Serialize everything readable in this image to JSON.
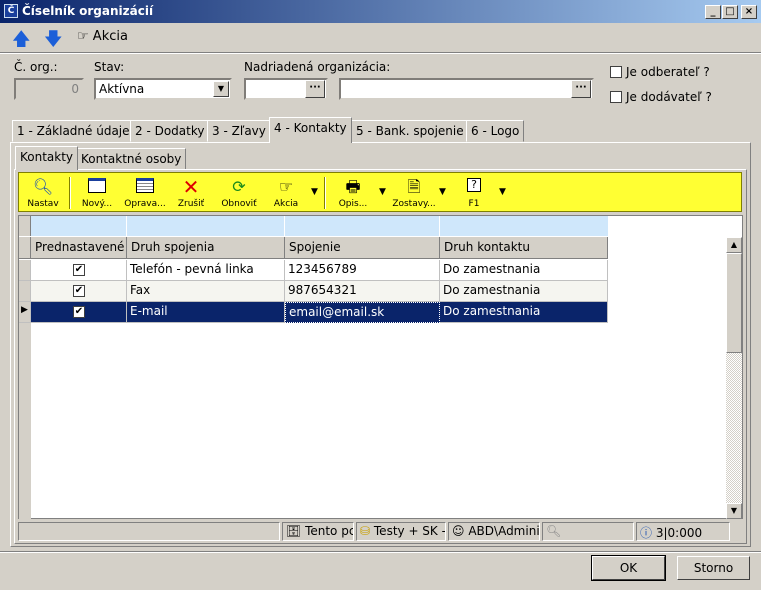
{
  "window": {
    "title": "Číselník organizácií",
    "icon": "app-icon"
  },
  "topbar": {
    "up_icon": "arrow-up-icon",
    "down_icon": "arrow-down-icon",
    "akcia": "Akcia"
  },
  "form": {
    "cislo_label": "Č. org.:",
    "cislo_value": "0",
    "stav_label": "Stav:",
    "stav_value": "Aktívna",
    "nadriadena_label": "Nadriadená organizácia:",
    "odberatel_label": "Je odberateľ ?",
    "dodavatel_label": "Je dodávateľ ?"
  },
  "tabs": [
    "1 - Základné údaje",
    "2 - Dodatky",
    "3 - Zľavy",
    "4 - Kontakty",
    "5 - Bank. spojenie",
    "6 - Logo"
  ],
  "subtabs": [
    "Kontakty",
    "Kontaktné osoby"
  ],
  "toolbar": {
    "nastav": "Nastav",
    "novy": "Nový...",
    "oprava": "Oprava...",
    "zrusit": "Zrušiť",
    "obnovit": "Obnoviť",
    "akcia": "Akcia",
    "opis": "Opis...",
    "zostavy": "Zostavy...",
    "f1": "F1"
  },
  "grid": {
    "columns": [
      "Prednastavené",
      "Druh spojenia",
      "Spojenie",
      "Druh kontaktu"
    ],
    "rows": [
      {
        "druh": "Telefón - pevná linka",
        "spojenie": "123456789",
        "kontakt": "Do zamestnania"
      },
      {
        "druh": "Fax",
        "spojenie": "987654321",
        "kontakt": "Do zamestnania"
      },
      {
        "druh": "E-mail",
        "spojenie": "email@email.sk",
        "kontakt": "Do zamestnania"
      }
    ]
  },
  "statusbar": {
    "s1": "Tento pc",
    "s2": "Testy + SK -",
    "s3": "ABD\\Admini:",
    "s4": "3|0:000"
  },
  "buttons": {
    "ok": "OK",
    "storno": "Storno"
  }
}
